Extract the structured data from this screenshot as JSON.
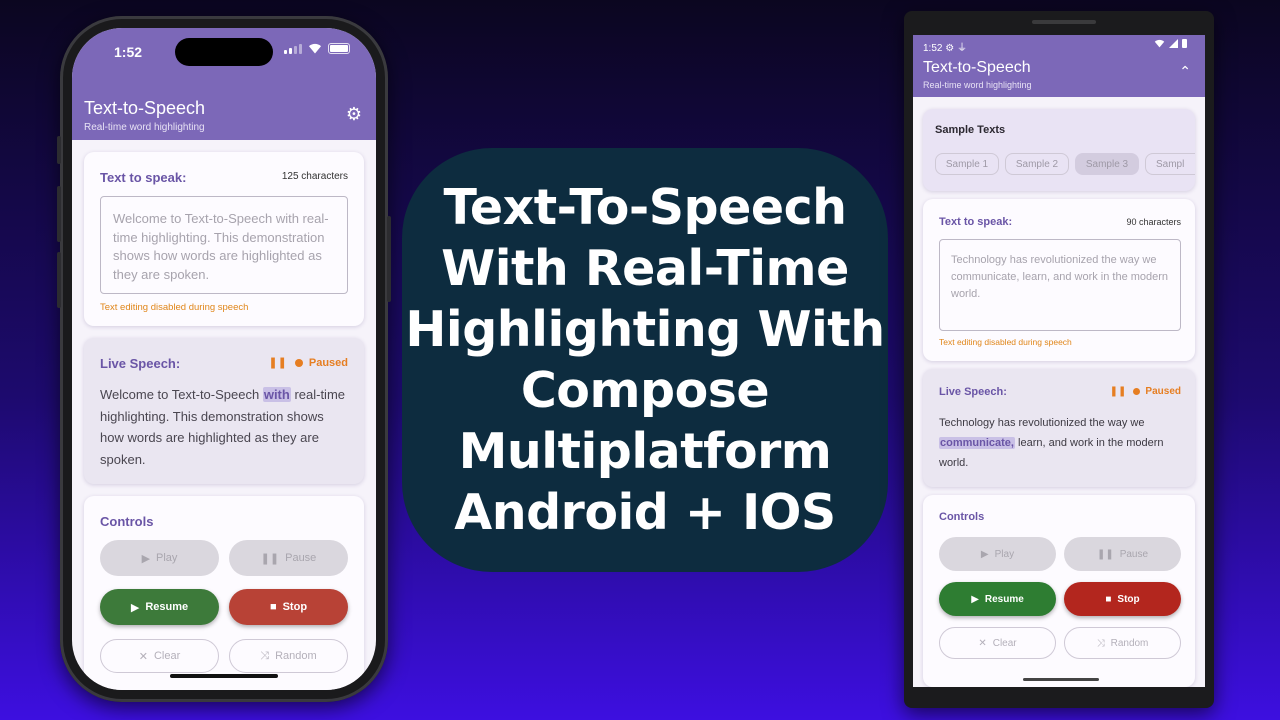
{
  "ios": {
    "status_time": "1:52",
    "app_title": "Text-to-Speech",
    "app_subtitle": "Real-time word highlighting",
    "settings_icon": "gear-icon",
    "text_card": {
      "label": "Text to speak:",
      "count": "125 characters",
      "text": "Welcome to Text-to-Speech with real-time highlighting. This demonstration shows how words are highlighted as they are spoken.",
      "note": "Text editing disabled during speech"
    },
    "live_card": {
      "label": "Live Speech:",
      "status": "Paused",
      "before": "Welcome to Text-to-Speech ",
      "highlight": "with",
      "after": " real-time highlighting. This demonstration shows how words are highlighted as they are spoken."
    },
    "controls": {
      "label": "Controls",
      "play": "Play",
      "pause": "Pause",
      "resume": "Resume",
      "stop": "Stop",
      "clear": "Clear",
      "random": "Random"
    }
  },
  "center": {
    "lines": [
      "Text-To-Speech",
      "With Real-Time",
      "Highlighting With",
      "Compose",
      "Multiplatform",
      "Android + IOS"
    ]
  },
  "android": {
    "status_time": "1:52",
    "app_title": "Text-to-Speech",
    "app_subtitle": "Real-time word highlighting",
    "samples": {
      "label": "Sample Texts",
      "chips": [
        "Sample 1",
        "Sample 2",
        "Sample 3",
        "Sampl"
      ],
      "selected_index": 2
    },
    "text_card": {
      "label": "Text to speak:",
      "count": "90 characters",
      "text": "Technology has revolutionized the way we communicate, learn, and work in the modern world.",
      "note": "Text editing disabled during speech"
    },
    "live_card": {
      "label": "Live Speech:",
      "status": "Paused",
      "before": "Technology has revolutionized the way we ",
      "highlight": "communicate,",
      "after": " learn, and work in the modern world."
    },
    "controls": {
      "label": "Controls",
      "play": "Play",
      "pause": "Pause",
      "resume": "Resume",
      "stop": "Stop",
      "clear": "Clear",
      "random": "Random"
    }
  },
  "colors": {
    "app_bar": "#7c68b8",
    "accent_label": "#6a55a6",
    "paused": "#e67e22",
    "resume": "#3d7a3a",
    "stop_ios": "#b84236",
    "stop_android": "#b3261e",
    "title_panel": "#0d2c3f"
  }
}
